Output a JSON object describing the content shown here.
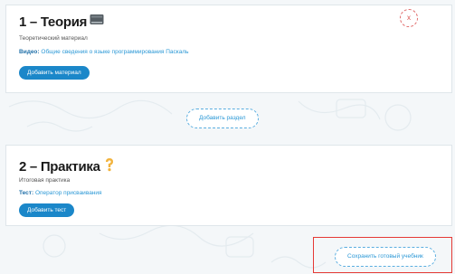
{
  "sections": [
    {
      "title": "1 – Теория",
      "icon": "book-icon",
      "subtitle": "Теоретический материал",
      "material_kind": "Видео:",
      "material_title": "Общие сведения о языке программирования Паскаль",
      "add_button": "Добавить материал",
      "delete_label": "x"
    },
    {
      "title": "2 – Практика",
      "icon": "question-icon",
      "subtitle": "Итоговая практика",
      "material_kind": "Тест:",
      "material_title": "Оператор присваивания",
      "add_button": "Добавить тест"
    }
  ],
  "add_section_button": "Добавить раздел",
  "save_button": "Сохранить готовый учебник",
  "colors": {
    "accent": "#1b87c9",
    "link": "#2b98d6",
    "highlight_border": "#e53935",
    "delete": "#d9534f"
  }
}
